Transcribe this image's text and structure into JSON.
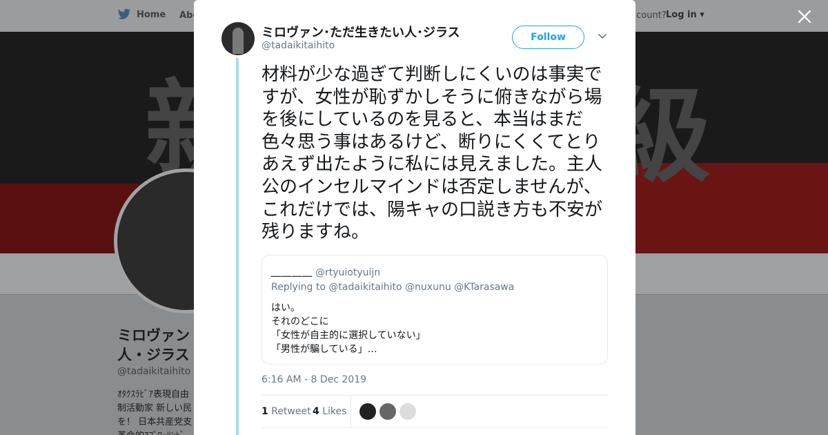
{
  "background_page": {
    "nav": {
      "home_label": "Home",
      "about_label": "Abo",
      "account_prompt": "ccount?",
      "login_label": "Log in"
    },
    "profile": {
      "name_line1": "ミロヴァン",
      "name_line2": "人・ジラス",
      "handle": "@tadaikitaihito",
      "bio_line1": "ｵﾀｸｽﾗﾋﾞｱ表現自由",
      "bio_line2": "制活動家 新しい民",
      "bio_line3": "を！ 日本共産党支",
      "bio_line4": "革命的ｱﾌﾟﾛｰﾘﾝﾋﾞ"
    }
  },
  "tweet": {
    "author_name": "ミロヴァン･ただ生きたい人･ジラス",
    "author_handle": "@tadaikitaihito",
    "follow_label": "Follow",
    "text": "材料が少な過ぎて判断しにくいのは事実ですが、女性が恥ずかしそうに俯きながら場を後にしているのを見ると、本当はまだ色々思う事はあるけど、断りにくくてとりあえず出たように私には見えました。主人公のインセルマインドは否定しませんが、これだけでは、陽キャの口説き方も不安が残りますね。",
    "timestamp": "6:16 AM - 8 Dec 2019",
    "retweet_count": "1",
    "retweet_label": "Retweet",
    "likes_count": "4",
    "likes_label": "Likes"
  },
  "quoted_tweet": {
    "name": "＿＿＿＿",
    "handle": "@rtyuiotyuijn",
    "replying_to_label": "Replying to",
    "mentions": [
      "@tadaikitaihito",
      "@nuxunu",
      "@KTarasawa"
    ],
    "body_lines": [
      "はい。",
      "それのどこに",
      "「女性が自主的に選択していない」",
      "「男性が騙している」…"
    ]
  },
  "icons": {
    "close": "close-icon",
    "chevron": "chevron-down-icon",
    "bird": "twitter-bird-icon"
  },
  "colors": {
    "accent": "#1da1f2",
    "thread_line": "#a8d8f5",
    "text_primary": "#14171a",
    "text_secondary": "#657786"
  }
}
